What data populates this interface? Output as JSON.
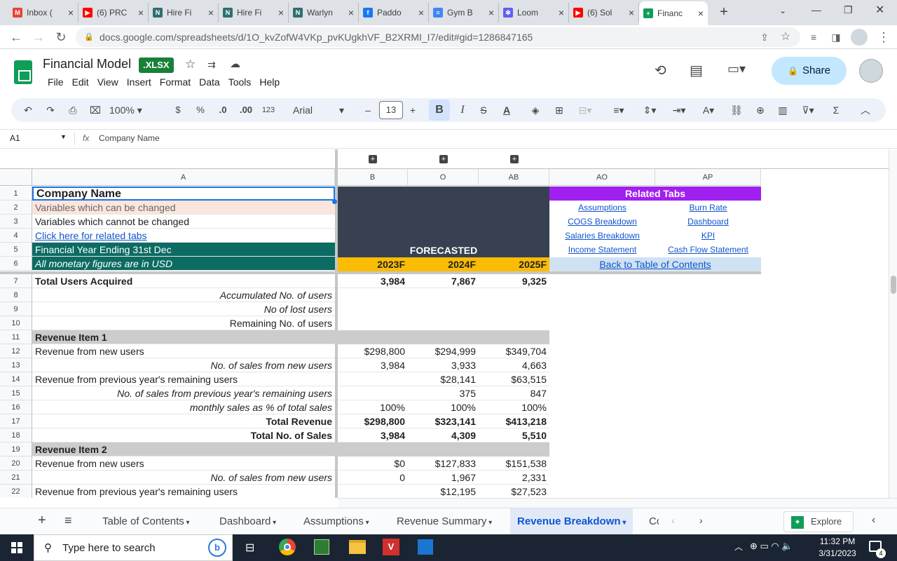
{
  "browser": {
    "tabs": [
      {
        "label": "Inbox (",
        "color": "#ea4335",
        "glyph": "M"
      },
      {
        "label": "(6) PRC",
        "color": "#ff0000",
        "glyph": "▶"
      },
      {
        "label": "Hire Fi",
        "color": "#2f6f6f",
        "glyph": "N"
      },
      {
        "label": "Hire Fi",
        "color": "#2f6f6f",
        "glyph": "N"
      },
      {
        "label": "Warlyn",
        "color": "#2f6f6f",
        "glyph": "N"
      },
      {
        "label": "Paddo",
        "color": "#1877f2",
        "glyph": "f"
      },
      {
        "label": "Gym B",
        "color": "#4285f4",
        "glyph": "≡"
      },
      {
        "label": "Loom",
        "color": "#625df5",
        "glyph": "✻"
      },
      {
        "label": "(6) Sol",
        "color": "#ff0000",
        "glyph": "▶"
      },
      {
        "label": "Financ",
        "color": "#0f9d58",
        "glyph": "+"
      }
    ],
    "url": "docs.google.com/spreadsheets/d/1O_kvZofW4VKp_pvKUgkhVF_B2XRMI_I7/edit#gid=1286847165"
  },
  "doc": {
    "title": "Financial Model",
    "badge": ".XLSX",
    "menu": [
      "File",
      "Edit",
      "View",
      "Insert",
      "Format",
      "Data",
      "Tools",
      "Help"
    ],
    "share_label": "Share"
  },
  "toolbar": {
    "zoom": "100%",
    "currency": "$",
    "percent": "%",
    "dec_less": ".0",
    "dec_more": ".00",
    "num_format": "123",
    "font": "Arial",
    "font_size": "13",
    "bold": "B",
    "italic": "I"
  },
  "formula": {
    "cell_ref": "A1",
    "fx": "fx",
    "content": "Company Name"
  },
  "grid": {
    "group_buttons": [
      "+",
      "+",
      "+"
    ],
    "columns": [
      "A",
      "B",
      "O",
      "AB",
      "AO",
      "AP"
    ],
    "rows": [
      "1",
      "2",
      "3",
      "4",
      "5",
      "6",
      "7",
      "8",
      "9",
      "10",
      "11",
      "12",
      "13",
      "14",
      "15",
      "16",
      "17",
      "18",
      "19",
      "20",
      "21",
      "22"
    ],
    "colA": [
      "Company Name",
      "Variables which can be changed",
      "Variables which cannot be changed",
      "Click here for related tabs",
      "Financial Year Ending 31st Dec",
      "All monetary figures are in USD",
      "Total Users Acquired",
      "Accumulated No. of users",
      "No of lost users",
      "Remaining No. of users",
      "Revenue Item 1",
      "Revenue from new users",
      "No. of sales from new users",
      "Revenue from previous year's remaining users",
      "No. of sales from previous year's remaining users",
      "monthly sales as % of total sales",
      "Total Revenue",
      "Total No. of Sales",
      "Revenue Item 2",
      "Revenue from new users",
      "No. of sales from new users",
      "Revenue from previous year's remaining users"
    ],
    "forecast_label": "FORECASTED",
    "years": [
      "2023F",
      "2024F",
      "2025F"
    ],
    "values": {
      "r7": [
        "3,984",
        "7,867",
        "9,325"
      ],
      "r12": [
        "$298,800",
        "$294,999",
        "$349,704"
      ],
      "r13": [
        "3,984",
        "3,933",
        "4,663"
      ],
      "r14": [
        "",
        "$28,141",
        "$63,515"
      ],
      "r15": [
        "",
        "375",
        "847"
      ],
      "r16": [
        "100%",
        "100%",
        "100%"
      ],
      "r17": [
        "$298,800",
        "$323,141",
        "$413,218"
      ],
      "r18": [
        "3,984",
        "4,309",
        "5,510"
      ],
      "r20": [
        "$0",
        "$127,833",
        "$151,538"
      ],
      "r21": [
        "0",
        "1,967",
        "2,331"
      ],
      "r22": [
        "",
        "$12,195",
        "$27,523"
      ]
    },
    "related": {
      "title": "Related Tabs",
      "links": [
        [
          "Assumptions",
          "Burn Rate"
        ],
        [
          "COGS Breakdown",
          "Dashboard"
        ],
        [
          "Salaries Breakdown",
          "KPI"
        ],
        [
          "Income Statement",
          "Cash Flow Statement"
        ]
      ],
      "back": "Back to Table of Contents"
    }
  },
  "sheets": {
    "tabs": [
      "Table of Contents",
      "Dashboard",
      "Assumptions",
      "Revenue Summary",
      "Revenue Breakdown",
      "Co"
    ],
    "active": "Revenue Breakdown",
    "explore": "Explore"
  },
  "taskbar": {
    "search_placeholder": "Type here to search",
    "time": "11:32 PM",
    "date": "3/31/2023",
    "notif_count": "4"
  },
  "colors": {
    "forecast_dark": "#374151",
    "teal": "#0c6b63",
    "year_gold": "#fbbc04",
    "related_purple": "#a020f0",
    "peach": "#fce5dc",
    "section_gray": "#cccccc"
  }
}
